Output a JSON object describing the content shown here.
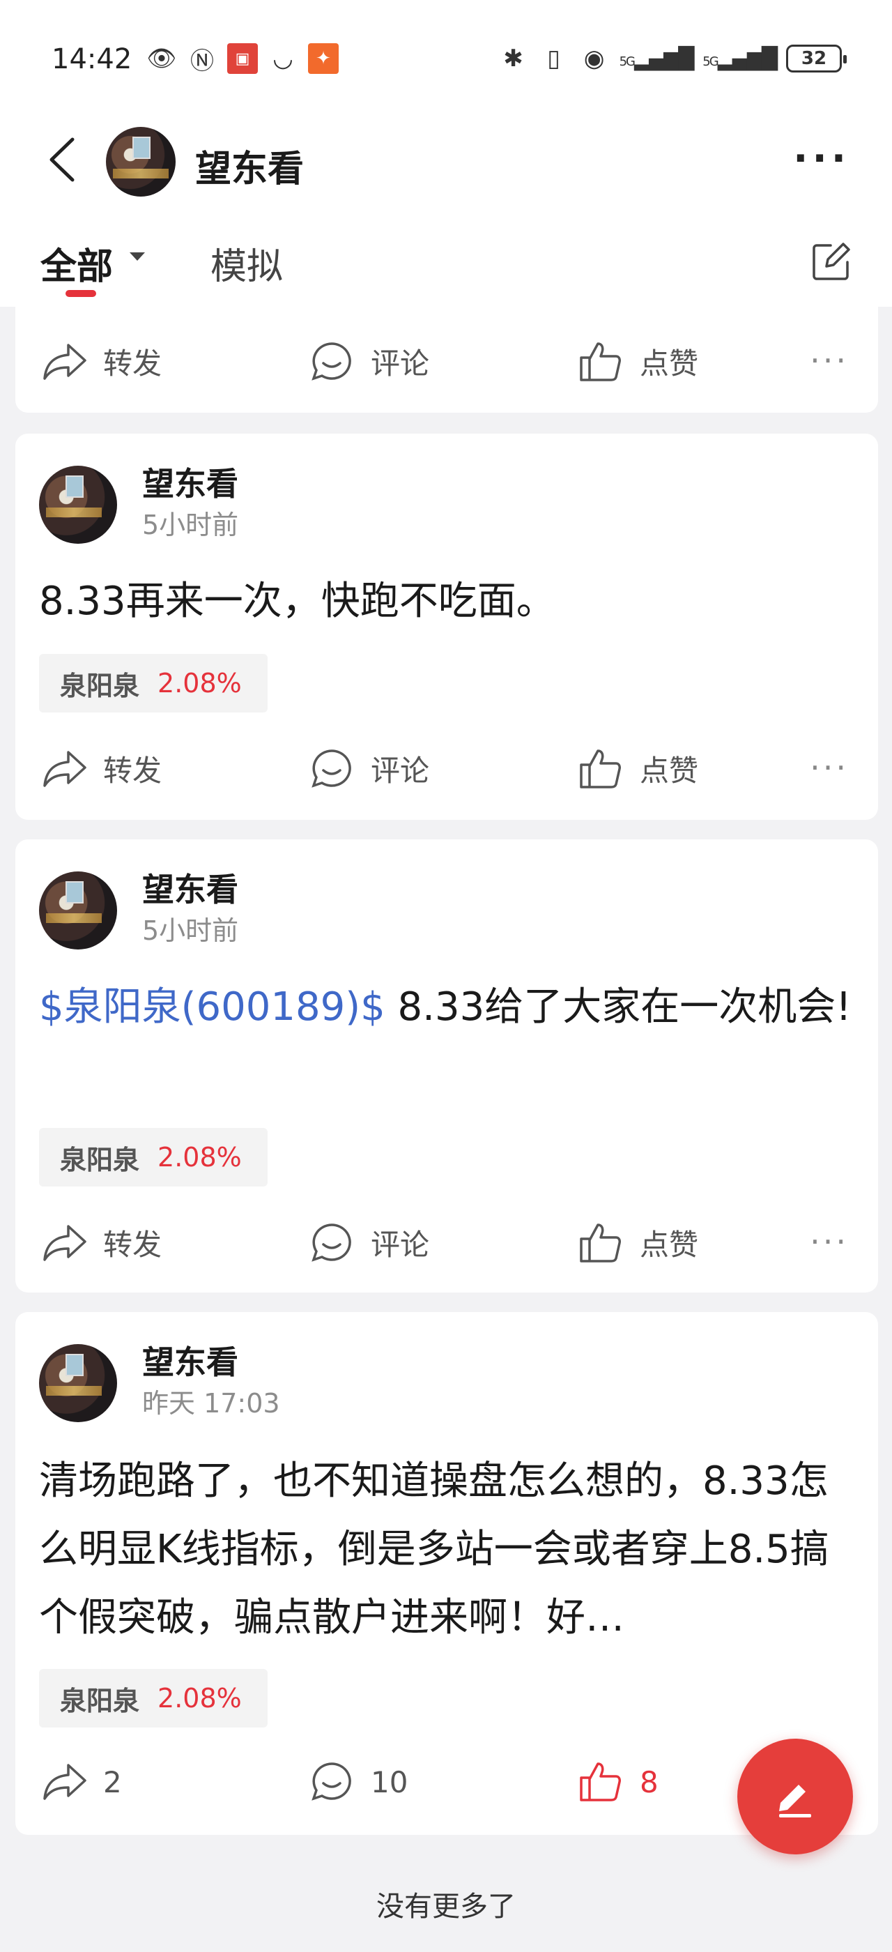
{
  "status_bar": {
    "time": "14:42",
    "icons_left": [
      "eye-icon",
      "nfc-icon",
      "app-badge-icon",
      "shield-icon",
      "app-orange-icon"
    ],
    "icons_right": [
      "bluetooth-icon",
      "vibrate-icon",
      "hotspot-icon",
      "signal-5g-icon",
      "signal-5g-icon"
    ],
    "signal_label_1": "5G",
    "signal_label_2": "5G",
    "battery": "32"
  },
  "header": {
    "title": "望东看"
  },
  "tabs": {
    "all": "全部",
    "simulated": "模拟"
  },
  "actions": {
    "share": "转发",
    "comment": "评论",
    "like": "点赞"
  },
  "posts": [
    {
      "author": "望东看",
      "time": "5小时前",
      "text": "8.33再来一次，快跑不吃面。",
      "stock_name": "泉阳泉",
      "stock_change": "2.08%"
    },
    {
      "author": "望东看",
      "time": "5小时前",
      "link_text": "$泉阳泉(600189)$",
      "text": " 8.33给了大家在一次机会!",
      "stock_name": "泉阳泉",
      "stock_change": "2.08%"
    },
    {
      "author": "望东看",
      "time": "昨天 17:03",
      "text": "清场跑路了，也不知道操盘怎么想的，8.33怎么明显K线指标，倒是多站一会或者穿上8.5搞个假突破，骗点散户进来啊！好…",
      "stock_name": "泉阳泉",
      "stock_change": "2.08%",
      "share_count": "2",
      "comment_count": "10",
      "like_count": "8"
    }
  ],
  "footer": "没有更多了",
  "colors": {
    "accent": "#e5323b",
    "link": "#3f68c8",
    "background": "#f2f2f4"
  }
}
